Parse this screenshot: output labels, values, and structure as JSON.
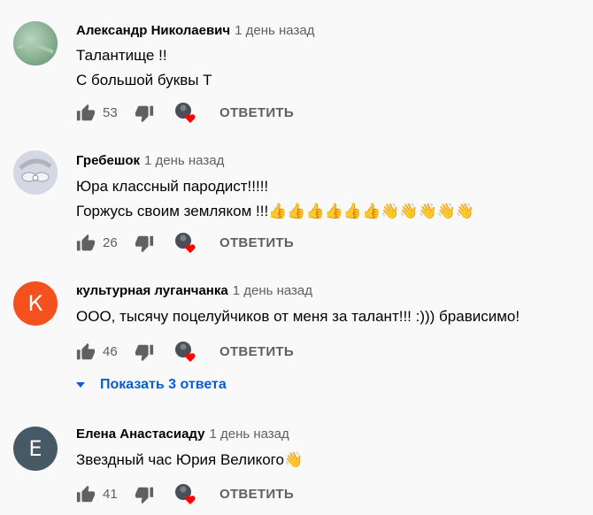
{
  "comments": [
    {
      "author": "Александр Николаевич",
      "time": "1 день назад",
      "lines": [
        "Талантище !!",
        "С большой буквы Т"
      ],
      "likes": "53",
      "avatar": {
        "kind": "image",
        "color": "#8fb89c",
        "icon": "green-photo-avatar"
      }
    },
    {
      "author": "Гребешок",
      "time": "1 день назад",
      "lines": [
        "Юра классный пародист!!!!!",
        "Горжусь своим земляком !!!👍👍👍👍👍👍👋👋👋👋👋"
      ],
      "likes": "26",
      "avatar": {
        "kind": "image",
        "color": "#d9dce8",
        "icon": "hair-comb-photo-avatar"
      }
    },
    {
      "author": "культурная луганчанка",
      "time": "1 день назад",
      "lines": [
        "ООО, тысячу поцелуйчиков от меня за талант!!! :))) брависимо!"
      ],
      "likes": "46",
      "avatar": {
        "kind": "letter",
        "letter": "К",
        "color": "#f4511e"
      }
    },
    {
      "author": "Елена Анастасиаду",
      "time": "1 день назад",
      "lines": [
        "Звездный час Юрия Великого👋"
      ],
      "likes": "41",
      "avatar": {
        "kind": "letter",
        "letter": "Е",
        "color": "#455a64"
      }
    }
  ],
  "reply_label": "ОТВЕТИТЬ",
  "show_replies": "Показать 3 ответа",
  "colors": {
    "link": "#065fd4",
    "secondary": "#606060",
    "heart": "#ff0000"
  }
}
